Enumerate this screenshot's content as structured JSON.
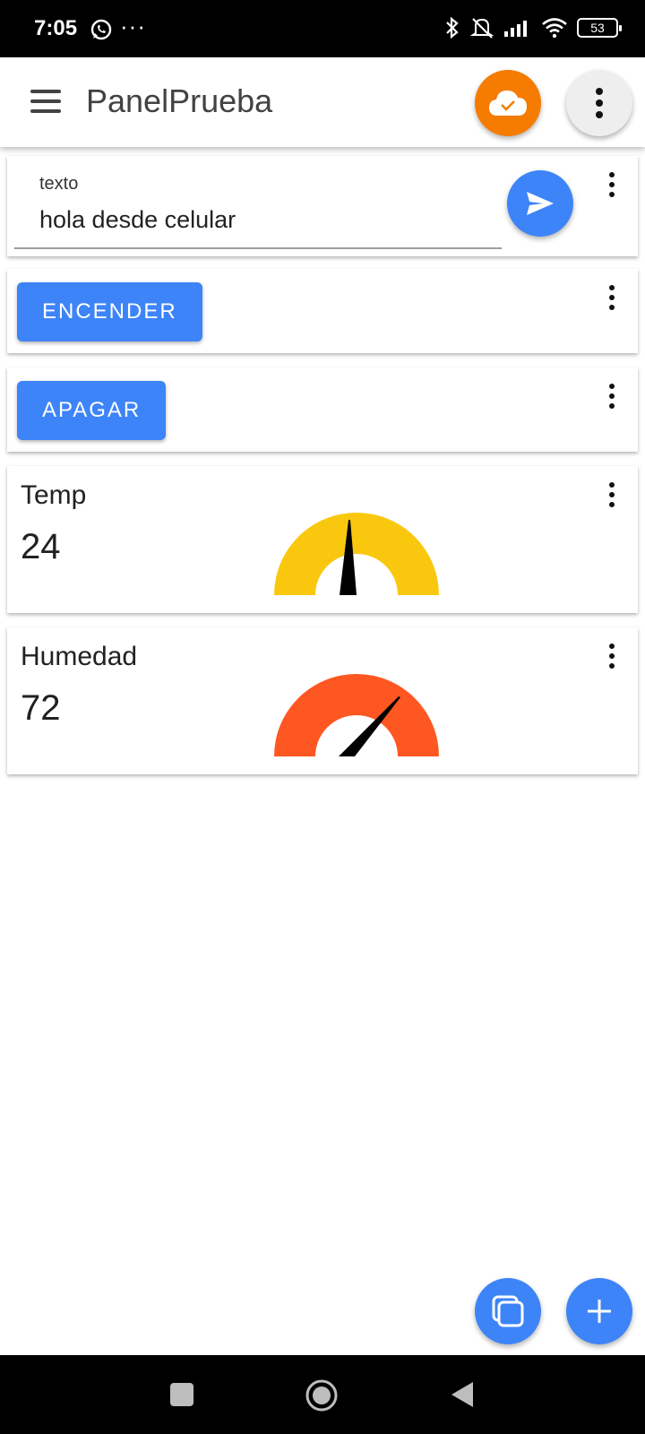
{
  "status_bar": {
    "time": "7:05",
    "dots": "···",
    "battery": "53",
    "icons": [
      "whatsapp-icon",
      "bluetooth-icon",
      "mute-icon",
      "signal-icon",
      "wifi-icon",
      "battery-icon"
    ]
  },
  "app_bar": {
    "title": "PanelPrueba",
    "cloud_color": "#f57c00"
  },
  "text_widget": {
    "label": "texto",
    "value": "hola desde celular"
  },
  "buttons": {
    "encender": "ENCENDER",
    "apagar": "APAGAR"
  },
  "gauges": [
    {
      "name": "Temp",
      "value": "24",
      "color": "#f9c80e"
    },
    {
      "name": "Humedad",
      "value": "72",
      "color": "#ff5722"
    }
  ],
  "colors": {
    "accent": "#3d84f8",
    "cloud": "#f57c00"
  }
}
